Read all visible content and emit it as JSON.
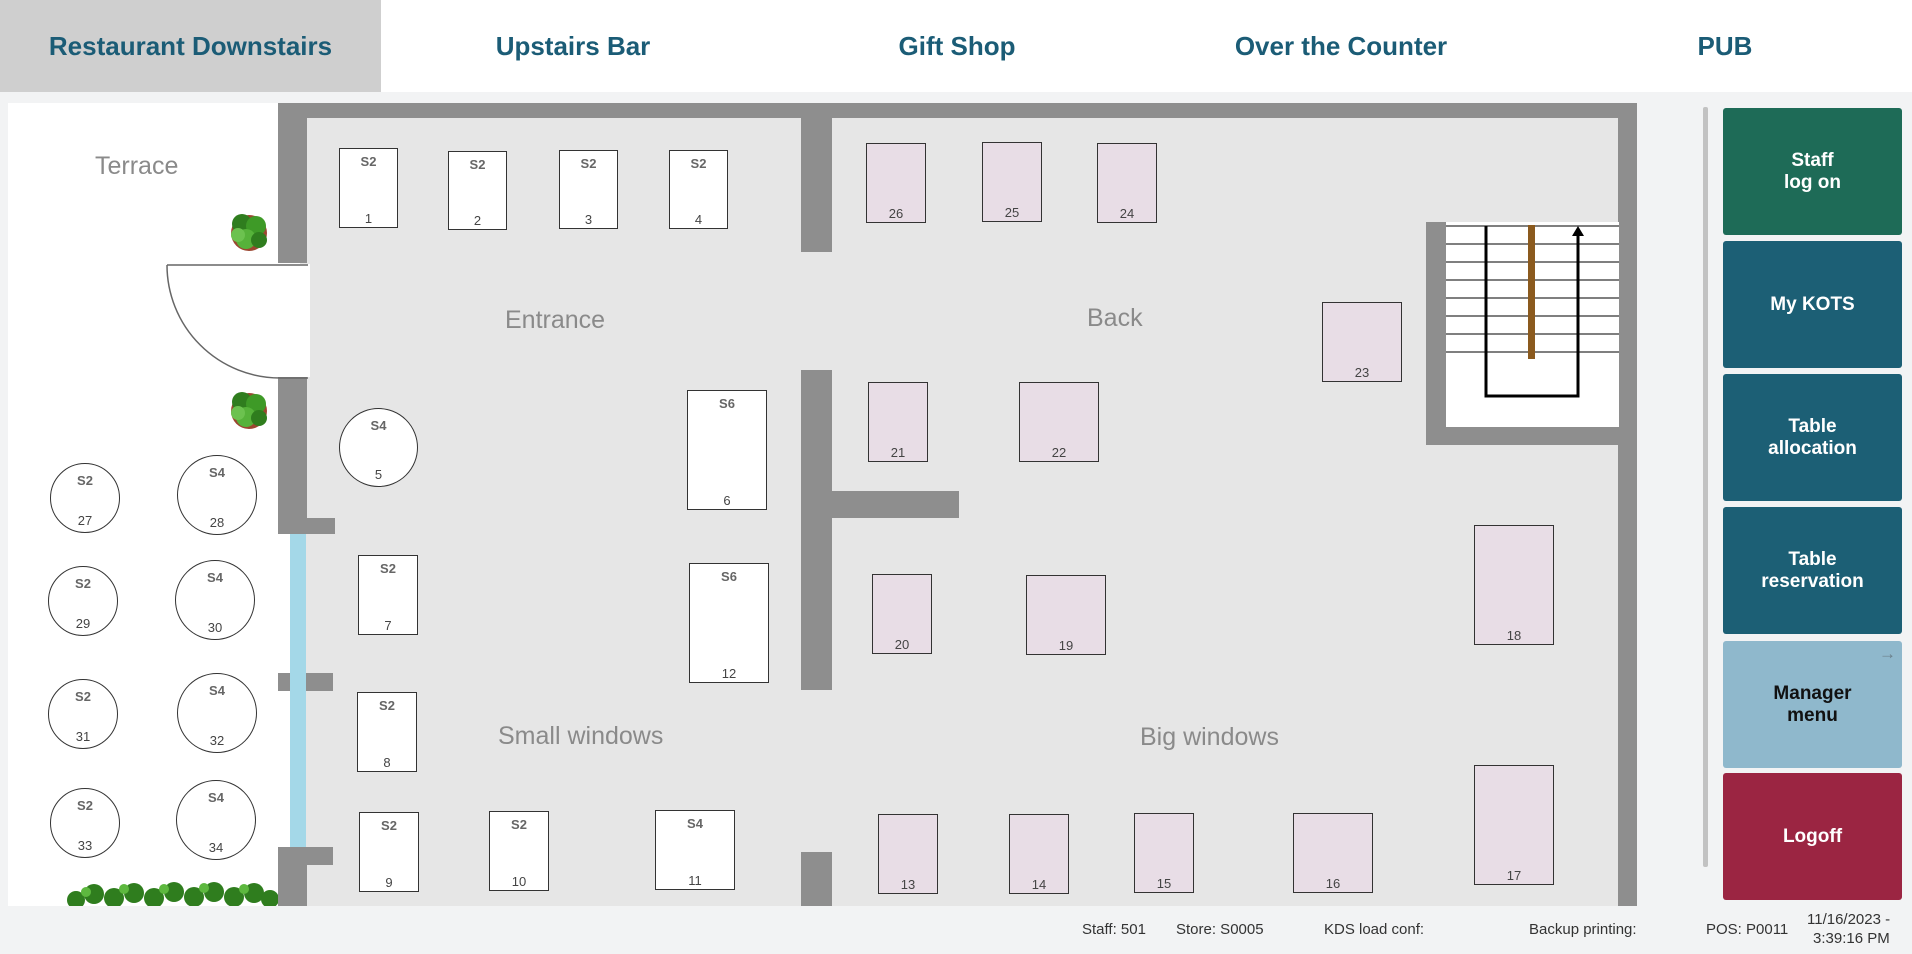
{
  "tabs": [
    {
      "label": "Restaurant Downstairs",
      "active": true
    },
    {
      "label": "Upstairs Bar",
      "active": false
    },
    {
      "label": "Gift Shop",
      "active": false
    },
    {
      "label": "Over the Counter",
      "active": false
    },
    {
      "label": "PUB",
      "active": false
    }
  ],
  "areas": {
    "terrace": "Terrace",
    "entrance": "Entrance",
    "back": "Back",
    "small_windows": "Small windows",
    "big_windows": "Big windows"
  },
  "tables": [
    {
      "num": "1",
      "size": "S2",
      "status": "free"
    },
    {
      "num": "2",
      "size": "S2",
      "status": "free"
    },
    {
      "num": "3",
      "size": "S2",
      "status": "free"
    },
    {
      "num": "4",
      "size": "S2",
      "status": "free"
    },
    {
      "num": "5",
      "size": "S4",
      "status": "free"
    },
    {
      "num": "6",
      "size": "S6",
      "status": "free"
    },
    {
      "num": "7",
      "size": "S2",
      "status": "free"
    },
    {
      "num": "8",
      "size": "S2",
      "status": "free"
    },
    {
      "num": "9",
      "size": "S2",
      "status": "free"
    },
    {
      "num": "10",
      "size": "S2",
      "status": "free"
    },
    {
      "num": "11",
      "size": "S4",
      "status": "free"
    },
    {
      "num": "12",
      "size": "S6",
      "status": "free"
    },
    {
      "num": "13",
      "size": "",
      "status": "pink"
    },
    {
      "num": "14",
      "size": "",
      "status": "pink"
    },
    {
      "num": "15",
      "size": "",
      "status": "pink"
    },
    {
      "num": "16",
      "size": "",
      "status": "pink"
    },
    {
      "num": "17",
      "size": "",
      "status": "pink"
    },
    {
      "num": "18",
      "size": "",
      "status": "pink"
    },
    {
      "num": "19",
      "size": "",
      "status": "pink"
    },
    {
      "num": "20",
      "size": "",
      "status": "pink"
    },
    {
      "num": "21",
      "size": "",
      "status": "pink"
    },
    {
      "num": "22",
      "size": "",
      "status": "pink"
    },
    {
      "num": "23",
      "size": "",
      "status": "pink"
    },
    {
      "num": "24",
      "size": "",
      "status": "pink"
    },
    {
      "num": "25",
      "size": "",
      "status": "pink"
    },
    {
      "num": "26",
      "size": "",
      "status": "pink"
    },
    {
      "num": "27",
      "size": "S2",
      "status": "free"
    },
    {
      "num": "28",
      "size": "S4",
      "status": "free"
    },
    {
      "num": "29",
      "size": "S2",
      "status": "free"
    },
    {
      "num": "30",
      "size": "S4",
      "status": "free"
    },
    {
      "num": "31",
      "size": "S2",
      "status": "free"
    },
    {
      "num": "32",
      "size": "S4",
      "status": "free"
    },
    {
      "num": "33",
      "size": "S2",
      "status": "free"
    },
    {
      "num": "34",
      "size": "S4",
      "status": "free"
    }
  ],
  "side_buttons": [
    {
      "label": "Staff\nlog on",
      "color": "#1e6b57"
    },
    {
      "label": "My KOTS",
      "color": "#1c5f75"
    },
    {
      "label": "Table\nallocation",
      "color": "#1c5f75"
    },
    {
      "label": "Table\nreservation",
      "color": "#1c5f75"
    },
    {
      "label": "Manager\nmenu",
      "color": "#8fb8cc"
    },
    {
      "label": "Logoff",
      "color": "#9b2542"
    }
  ],
  "status": {
    "staff": "Staff: 501",
    "store": "Store: S0005",
    "kds": "KDS load conf:",
    "backup": "Backup printing:",
    "pos": "POS: P0011",
    "date": "11/16/2023 -",
    "time": "3:39:16 PM"
  },
  "colors": {
    "tab_text": "#1b5c76",
    "free_table": "#ffffff",
    "occupied_table": "#e8dde6"
  }
}
